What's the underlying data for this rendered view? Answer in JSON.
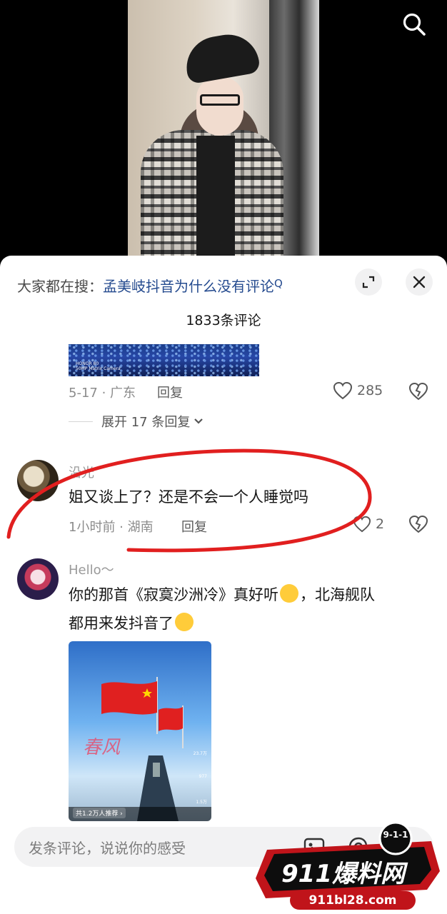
{
  "search_bar": {
    "prefix": "大家都在搜：",
    "query": "孟美岐抖音为什么没有评论",
    "query_icon": "Q"
  },
  "comments_header": {
    "count_label": "1833条评论"
  },
  "prev_comment": {
    "image_caption_line1": "HONOR 80",
    "image_caption_line2": "50MP Matrix Camera",
    "meta": "5-17 · 广东",
    "reply_label": "回复",
    "likes": "285",
    "expand_label": "展开 17 条回复"
  },
  "comment_1": {
    "username": "沿光",
    "text": "姐又谈上了？还是不会一个人睡觉吗",
    "meta": "1小时前 · 湖南",
    "reply_label": "回复",
    "likes": "2"
  },
  "comment_2": {
    "username": "Hello～",
    "text_line1": "你的那首《寂寞沙洲冷》真好听",
    "text_line1b": "，北海舰队",
    "text_line2": "都用来发抖音了",
    "image_watermark": "春风",
    "image_tag": "共1.2万人推荐 ›",
    "image_side1": "23.7万",
    "image_side2": "977",
    "image_side3": "1.5万"
  },
  "input_bar": {
    "placeholder": "发条评论，说说你的感受"
  },
  "watermark": {
    "badge": "9-1-1",
    "brand": "911爆料网",
    "url": "911bl28.com"
  },
  "colors": {
    "accent_link": "#254b8f",
    "annotation_red": "#e11f1f",
    "sheet_bg": "#ffffff"
  }
}
